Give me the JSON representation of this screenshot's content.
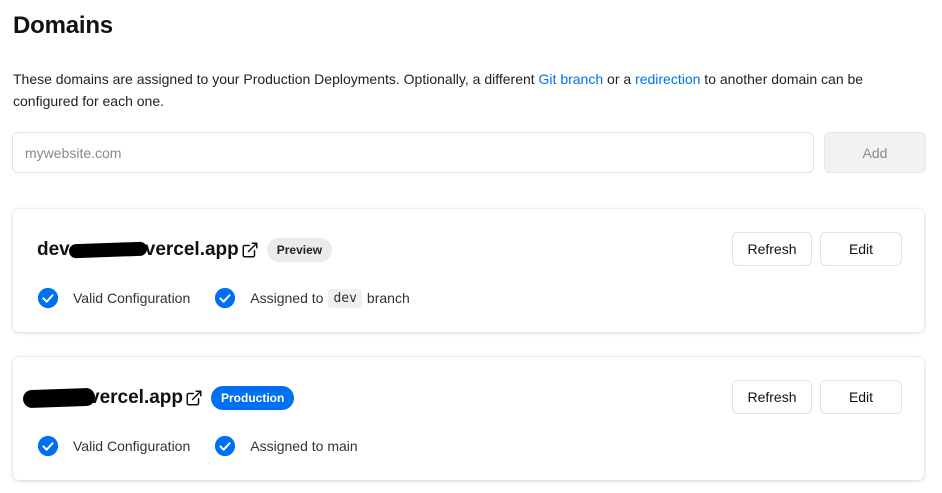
{
  "page": {
    "title": "Domains",
    "description": {
      "before": "These domains are assigned to your Production Deployments. Optionally, a different ",
      "link1": "Git branch",
      "middle": " or a ",
      "link2": "redirection",
      "after": " to another domain can be configured for each one."
    }
  },
  "add_form": {
    "placeholder": "mywebsite.com",
    "value": "",
    "add_label": "Add"
  },
  "domains": [
    {
      "name_prefix": "dev",
      "name_suffix": "vercel.app",
      "badge": "Preview",
      "status_config": "Valid Configuration",
      "assigned_before": "Assigned to",
      "branch": "dev",
      "assigned_after": "branch",
      "refresh_label": "Refresh",
      "edit_label": "Edit"
    },
    {
      "name_suffix": "vercel.app",
      "badge": "Production",
      "status_config": "Valid Configuration",
      "assigned": "Assigned to main",
      "refresh_label": "Refresh",
      "edit_label": "Edit"
    }
  ],
  "colors": {
    "accent": "#0070f3",
    "badge_preview_bg": "#ebebeb",
    "check": "#0070f3"
  },
  "icons": {
    "external_link": "external-link-icon",
    "check": "check-circle-icon"
  }
}
